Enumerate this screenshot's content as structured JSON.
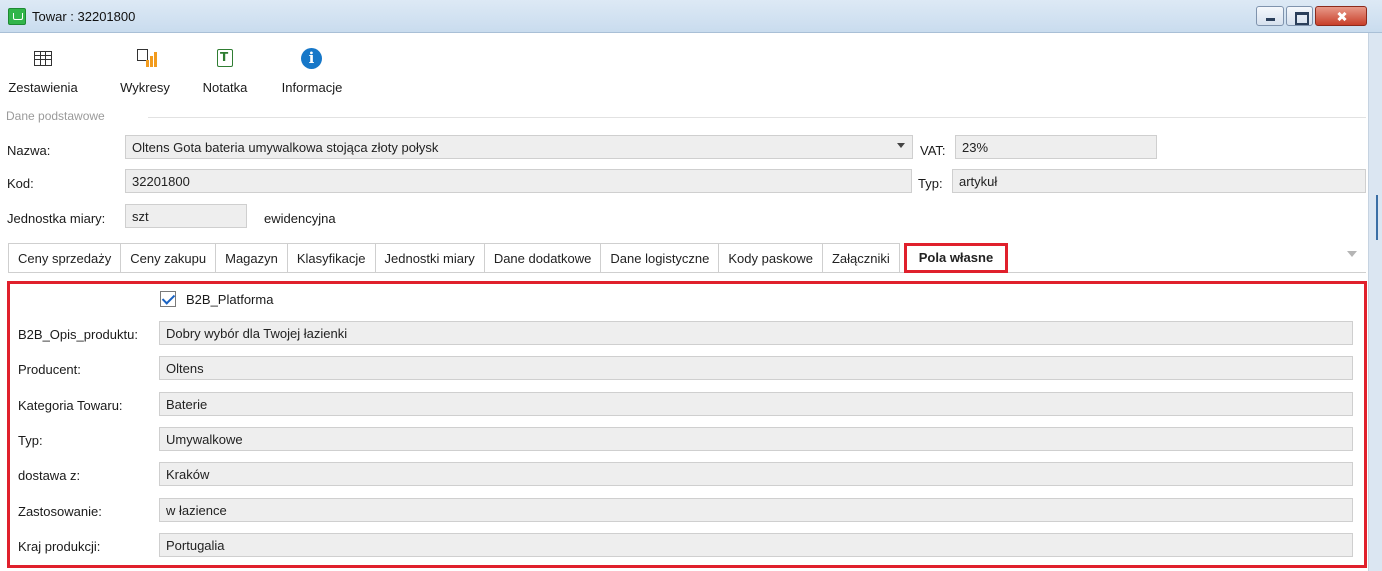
{
  "window": {
    "title": "Towar : 32201800"
  },
  "toolbar": {
    "items": [
      {
        "label": "Zestawienia",
        "icon": "table-grid-icon"
      },
      {
        "label": "Wykresy",
        "icon": "chart-icon"
      },
      {
        "label": "Notatka",
        "icon": "note-icon"
      },
      {
        "label": "Informacje",
        "icon": "info-icon"
      }
    ]
  },
  "basic": {
    "group_label": "Dane podstawowe",
    "name_label": "Nazwa:",
    "name_value": "Oltens Gota bateria umywalkowa stojąca złoty połysk",
    "vat_label": "VAT:",
    "vat_value": "23%",
    "code_label": "Kod:",
    "code_value": "32201800",
    "type_label": "Typ:",
    "type_value": "artykuł",
    "unit_label": "Jednostka miary:",
    "unit_value": "szt",
    "unit_note": "ewidencyjna"
  },
  "tabs": [
    "Ceny sprzedaży",
    "Ceny zakupu",
    "Magazyn",
    "Klasyfikacje",
    "Jednostki miary",
    "Dane dodatkowe",
    "Dane logistyczne",
    "Kody paskowe",
    "Załączniki",
    "Pola własne"
  ],
  "active_tab": "Pola własne",
  "custom": {
    "checkbox_label": "B2B_Platforma",
    "checkbox_checked": true,
    "fields": [
      {
        "label": "B2B_Opis_produktu:",
        "value": "Dobry wybór dla Twojej łazienki"
      },
      {
        "label": "Producent:",
        "value": "Oltens"
      },
      {
        "label": "Kategoria Towaru:",
        "value": "Baterie"
      },
      {
        "label": "Typ:",
        "value": "Umywalkowe"
      },
      {
        "label": "dostawa z:",
        "value": "Kraków"
      },
      {
        "label": "Zastosowanie:",
        "value": "w łazience"
      },
      {
        "label": "Kraj produkcji:",
        "value": "Portugalia"
      }
    ]
  },
  "colors": {
    "highlight": "#e0202c",
    "checkbox_check": "#1a62c2",
    "info_icon": "#1677c8",
    "chart_bars": "#f29b1d"
  }
}
